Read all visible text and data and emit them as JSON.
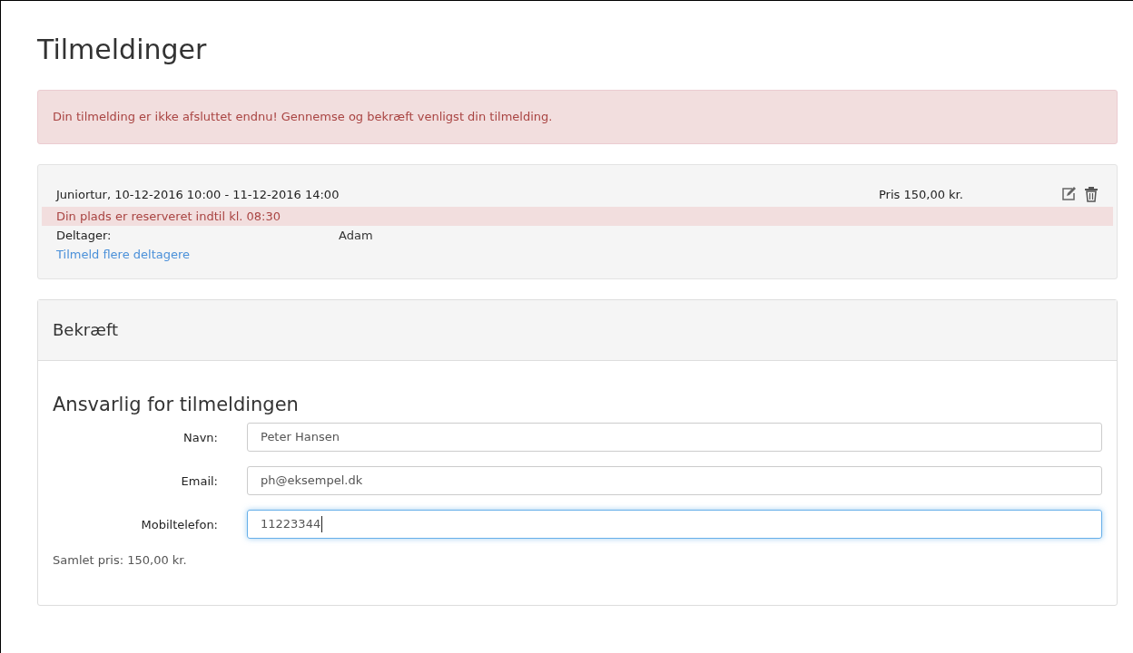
{
  "page_title": "Tilmeldinger",
  "alert": "Din tilmelding er ikke afsluttet endnu! Gennemse og bekræft venligst din tilmelding.",
  "registration": {
    "event": "Juniortur, 10-12-2016 10:00 - 11-12-2016 14:00",
    "price": "Pris 150,00 kr.",
    "reservation_notice": "Din plads er reserveret indtil kl. 08:30",
    "participant_label": "Deltager:",
    "participant": "Adam",
    "add_link": "Tilmeld flere deltagere"
  },
  "confirm": {
    "header": "Bekræft",
    "section_title": "Ansvarlig for tilmeldingen",
    "fields": [
      {
        "label": "Navn:",
        "value": "Peter Hansen",
        "focused": false
      },
      {
        "label": "Email:",
        "value": "ph@eksempel.dk",
        "focused": false
      },
      {
        "label": "Mobiltelefon:",
        "value": "11223344",
        "focused": true
      }
    ],
    "total": "Samlet pris: 150,00 kr."
  }
}
